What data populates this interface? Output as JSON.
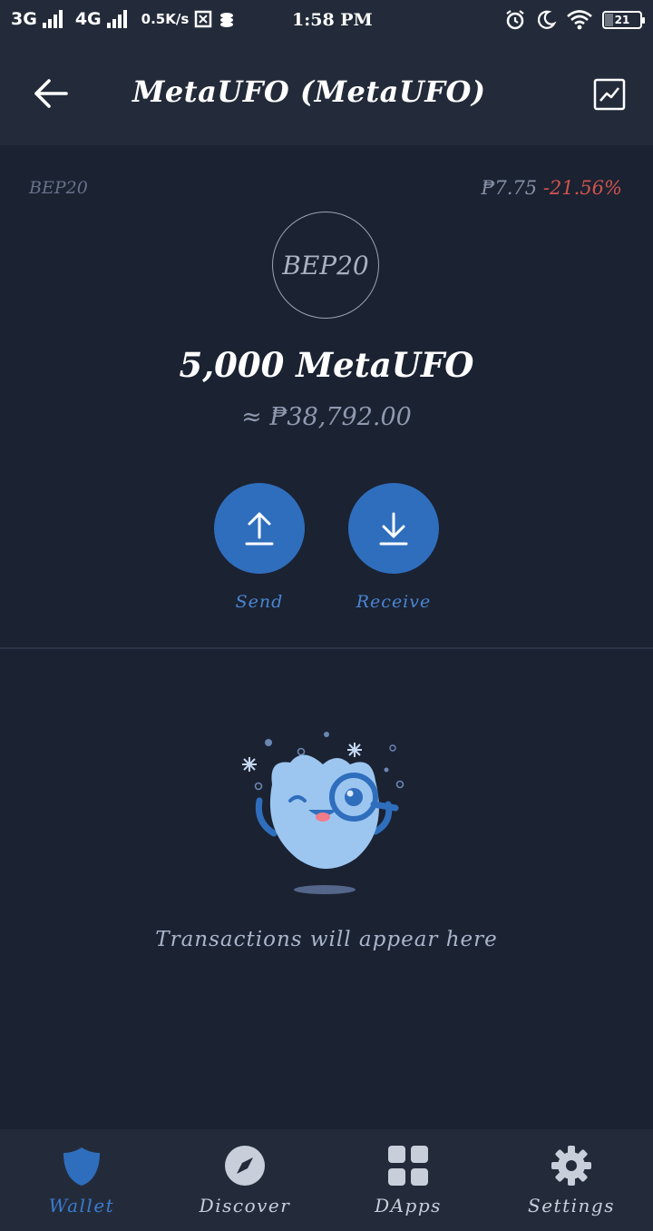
{
  "status_bar": {
    "network1": "3G",
    "network2": "4G",
    "speed": "0.5K/s",
    "time": "1:58 PM",
    "battery": "21"
  },
  "header": {
    "title": "MetaUFO (MetaUFO)"
  },
  "token": {
    "network_tag": "BEP20",
    "price": "₱7.75",
    "change": "-21.56%",
    "logo_text": "BEP20",
    "balance": "5,000 MetaUFO",
    "fiat_value": "≈ ₱38,792.00"
  },
  "actions": {
    "send_label": "Send",
    "receive_label": "Receive"
  },
  "empty_state": {
    "message": "Transactions will appear here"
  },
  "bottom_nav": {
    "items": [
      {
        "label": "Wallet",
        "icon": "shield-icon",
        "active": true
      },
      {
        "label": "Discover",
        "icon": "compass-icon",
        "active": false
      },
      {
        "label": "DApps",
        "icon": "grid-icon",
        "active": false
      },
      {
        "label": "Settings",
        "icon": "gear-icon",
        "active": false
      }
    ]
  },
  "colors": {
    "background": "#1b2232",
    "bar": "#232b3a",
    "accent": "#2f6ebd",
    "negative": "#d1534d"
  }
}
